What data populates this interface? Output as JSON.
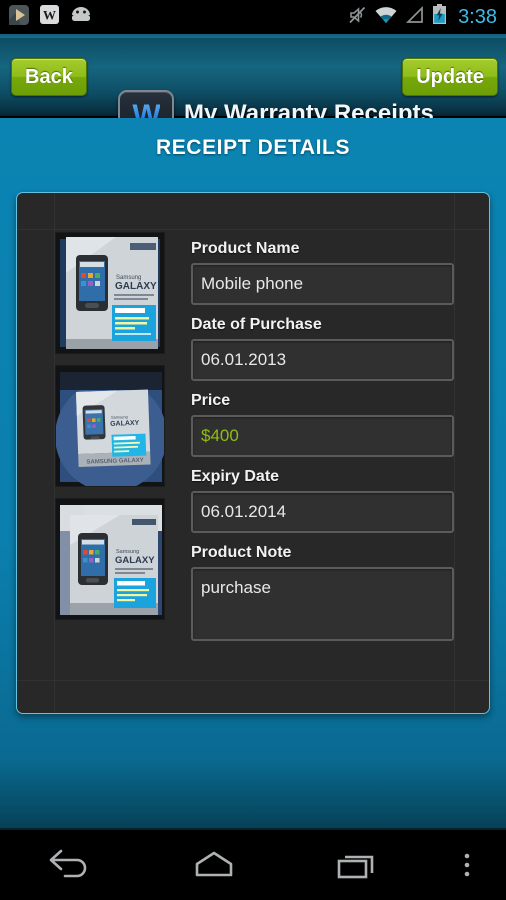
{
  "status_bar": {
    "time": "3:38",
    "left_icons": [
      "media-player-icon",
      "wikipedia-w-icon",
      "android-robot-icon"
    ],
    "right_icons": [
      "mute-vibrate-off-icon",
      "wifi-icon",
      "signal-no-service-icon",
      "battery-charging-icon"
    ],
    "clock_color": "#3dbbe8"
  },
  "action_bar": {
    "back_label": "Back",
    "update_label": "Update",
    "app_title": "My Warranty Receipts",
    "logo_letter": "W",
    "button_color": "#8fbd1a"
  },
  "page": {
    "heading": "RECEIPT DETAILS",
    "background_color": "#0b7fae",
    "panel_border_color": "#63c2de"
  },
  "receipt": {
    "thumbnails": [
      {
        "name": "receipt-photo-1",
        "alt": "Samsung Galaxy Ace box photo top view"
      },
      {
        "name": "receipt-photo-2",
        "alt": "Samsung Galaxy Ace box on blue chair"
      },
      {
        "name": "receipt-photo-3",
        "alt": "Samsung Galaxy Ace box angled view"
      }
    ],
    "fields": [
      {
        "key": "product_name",
        "label": "Product Name",
        "value": "Mobile phone",
        "multiline": false,
        "accent": false
      },
      {
        "key": "date_purchase",
        "label": "Date of Purchase",
        "value": "06.01.2013",
        "multiline": false,
        "accent": false
      },
      {
        "key": "price",
        "label": "Price",
        "value": "$400",
        "multiline": false,
        "accent": true
      },
      {
        "key": "expiry_date",
        "label": "Expiry Date",
        "value": "06.01.2014",
        "multiline": false,
        "accent": false
      },
      {
        "key": "product_note",
        "label": "Product Note",
        "value": "purchase",
        "multiline": true,
        "accent": false
      }
    ],
    "price_accent_color": "#8fbe10"
  },
  "nav_bar": {
    "buttons": [
      "back-nav-icon",
      "home-nav-icon",
      "recents-nav-icon",
      "overflow-menu-icon"
    ]
  }
}
